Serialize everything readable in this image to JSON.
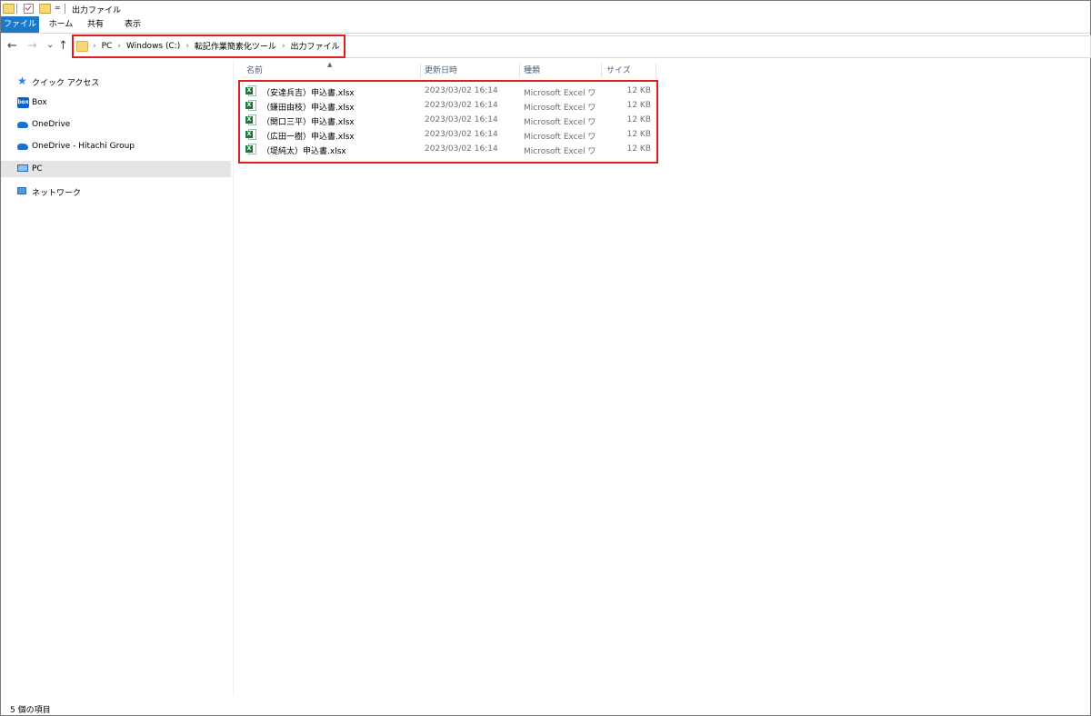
{
  "window": {
    "title": "出力ファイル",
    "qa_dropdown": "="
  },
  "ribbon": {
    "tabs": [
      "ファイル",
      "ホーム",
      "共有",
      "表示"
    ]
  },
  "nav_buttons": {
    "back": "←",
    "forward": "→",
    "recent": "⌄",
    "up": "↑"
  },
  "address": {
    "separator": "›",
    "crumbs": [
      "PC",
      "Windows (C:)",
      "転記作業簡素化ツール",
      "出力ファイル"
    ]
  },
  "sidebar": {
    "items": [
      {
        "label": "クイック アクセス",
        "icon": "star-icon"
      },
      {
        "label": "Box",
        "icon": "box-icon",
        "icon_text": "box"
      },
      {
        "label": "OneDrive",
        "icon": "cloud-icon"
      },
      {
        "label": "OneDrive - Hitachi Group",
        "icon": "cloud-icon"
      },
      {
        "label": "PC",
        "icon": "pc-icon",
        "selected": true
      },
      {
        "label": "ネットワーク",
        "icon": "network-icon"
      }
    ]
  },
  "file_list": {
    "sort_indicator": "▲",
    "columns": [
      "名前",
      "更新日時",
      "種類",
      "サイズ"
    ],
    "files": [
      {
        "name": "（安達兵吉）申込書.xlsx",
        "modified": "2023/03/02 16:14",
        "type": "Microsoft Excel ワ...",
        "size": "12 KB"
      },
      {
        "name": "（鎌田由枝）申込書.xlsx",
        "modified": "2023/03/02 16:14",
        "type": "Microsoft Excel ワ...",
        "size": "12 KB"
      },
      {
        "name": "（関口三平）申込書.xlsx",
        "modified": "2023/03/02 16:14",
        "type": "Microsoft Excel ワ...",
        "size": "12 KB"
      },
      {
        "name": "（広田一樹）申込書.xlsx",
        "modified": "2023/03/02 16:14",
        "type": "Microsoft Excel ワ...",
        "size": "12 KB"
      },
      {
        "name": "（堤純太）申込書.xlsx",
        "modified": "2023/03/02 16:14",
        "type": "Microsoft Excel ワ...",
        "size": "12 KB"
      }
    ],
    "excel_badge": "X"
  },
  "status": {
    "item_count": "5 個の項目"
  },
  "colors": {
    "highlight": "#e01e1e",
    "file_tab": "#1979ca",
    "selected_bg": "#e5e5e5"
  }
}
